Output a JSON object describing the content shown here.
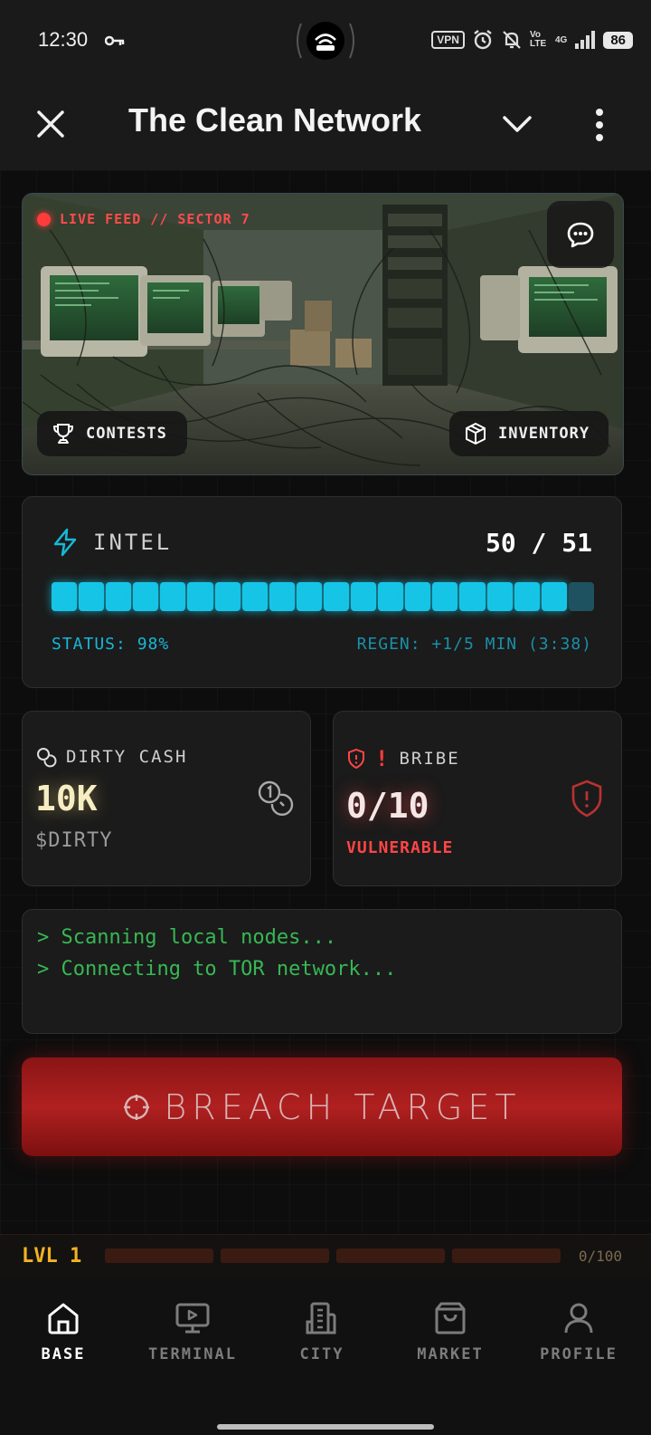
{
  "status_bar": {
    "time": "12:30",
    "vpn_label": "VPN",
    "volte_label": "Vo LTE",
    "network_label": "4G",
    "battery": "86",
    "icons": [
      "key-icon",
      "hotspot-icon",
      "alarm-icon",
      "mute-icon",
      "signal-icon"
    ]
  },
  "app_bar": {
    "title": "The Clean Network",
    "icons": [
      "close-icon",
      "chevron-down-icon",
      "more-vert-icon"
    ]
  },
  "feed": {
    "live_label": "LIVE FEED // SECTOR 7",
    "contests_label": "CONTESTS",
    "inventory_label": "INVENTORY"
  },
  "intel": {
    "label": "INTEL",
    "count": "50 / 51",
    "level": 0.98,
    "status": "STATUS: 98%",
    "regen": "REGEN: +1/5 MIN (3:38)",
    "color": "#16c5e6"
  },
  "cash": {
    "label": "DIRTY CASH",
    "value": "10K",
    "unit": "$DIRTY"
  },
  "bribe": {
    "label": "BRIBE",
    "value": "0/10",
    "status": "VULNERABLE",
    "color": "#ff4545"
  },
  "terminal": {
    "lines": [
      "> Scanning local nodes...",
      "> Connecting to TOR network..."
    ]
  },
  "breach": {
    "label": "BREACH TARGET"
  },
  "level": {
    "label": "LVL 1",
    "xp": "0/100",
    "progress": 0
  },
  "nav": {
    "items": [
      {
        "label": "BASE",
        "icon": "home-icon",
        "active": true
      },
      {
        "label": "TERMINAL",
        "icon": "monitor-icon",
        "active": false
      },
      {
        "label": "CITY",
        "icon": "building-icon",
        "active": false
      },
      {
        "label": "MARKET",
        "icon": "shopping-bag-icon",
        "active": false
      },
      {
        "label": "PROFILE",
        "icon": "user-icon",
        "active": false
      }
    ]
  }
}
